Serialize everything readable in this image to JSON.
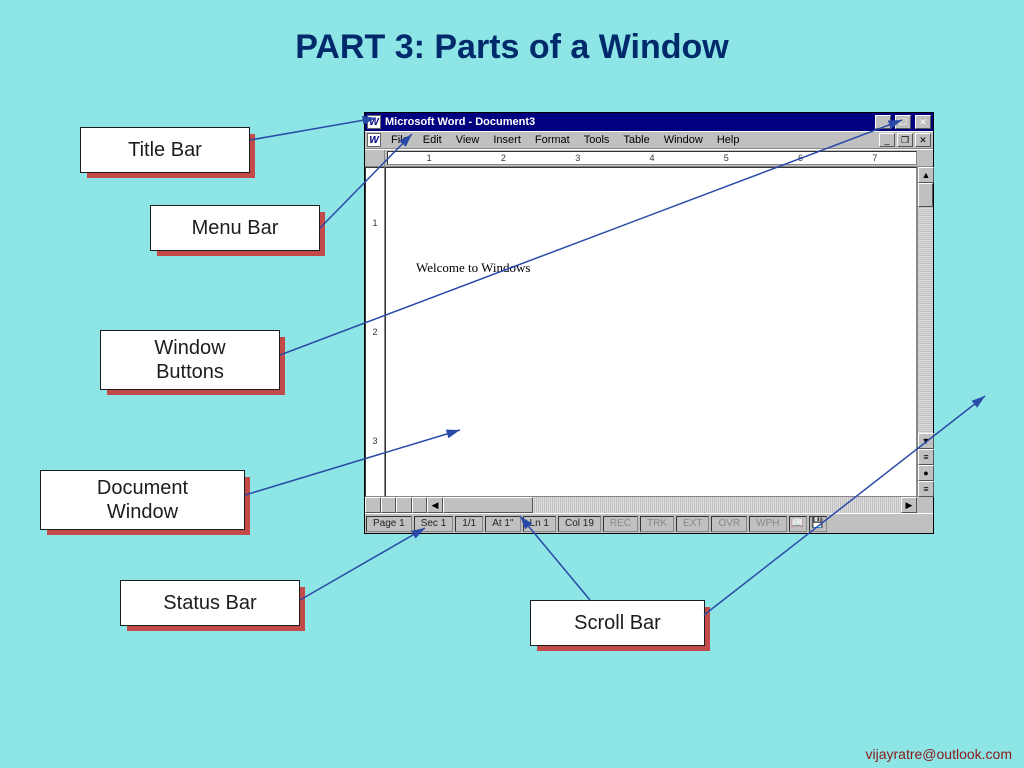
{
  "slide": {
    "title": "PART 3:   Parts of a Window"
  },
  "callouts": {
    "title_bar": "Title Bar",
    "menu_bar": "Menu Bar",
    "window_buttons": "Window\nButtons",
    "document_window": "Document\nWindow",
    "status_bar": "Status Bar",
    "scroll_bar": "Scroll Bar"
  },
  "word": {
    "title": "Microsoft Word - Document3",
    "menus": [
      "File",
      "Edit",
      "View",
      "Insert",
      "Format",
      "Tools",
      "Table",
      "Window",
      "Help"
    ],
    "ruler_h": [
      "1",
      "2",
      "3",
      "4",
      "5",
      "6",
      "7"
    ],
    "ruler_v": [
      "1",
      "2",
      "3"
    ],
    "document_text": "Welcome to Windows",
    "status": {
      "page": "Page 1",
      "sec": "Sec 1",
      "pages": "1/1",
      "at": "At 1\"",
      "ln": "Ln 1",
      "col": "Col 19",
      "indicators": [
        "REC",
        "TRK",
        "EXT",
        "OVR",
        "WPH"
      ]
    }
  },
  "footer": "vijayratre@outlook.com"
}
